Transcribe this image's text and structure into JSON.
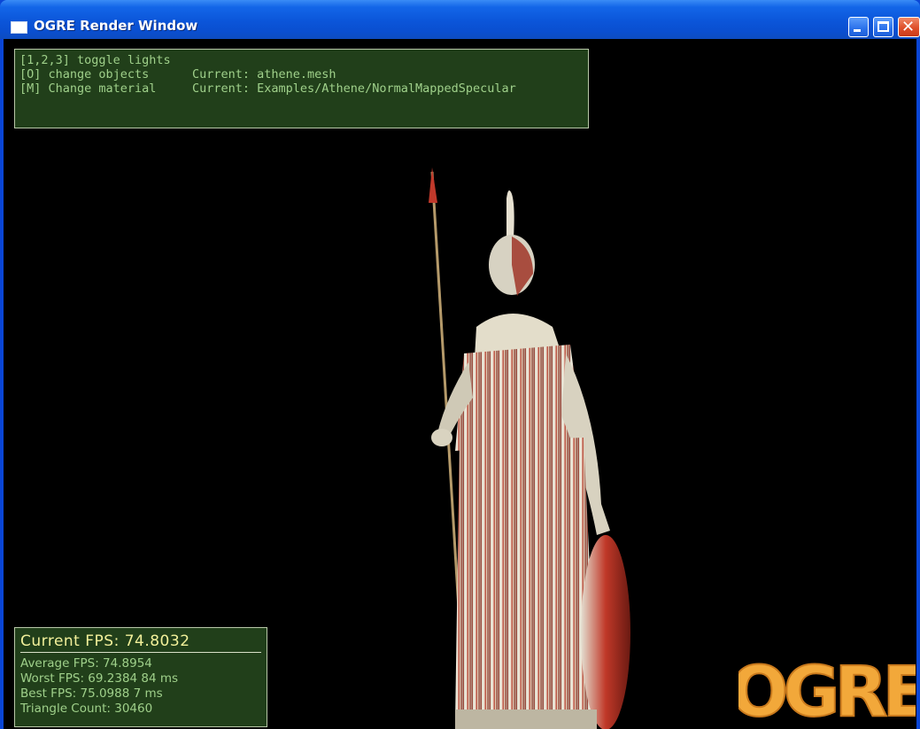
{
  "window": {
    "title": "OGRE Render Window",
    "controls": {
      "minimize_icon": "minimize-icon",
      "maximize_icon": "maximize-icon",
      "close_icon": "close-icon"
    }
  },
  "help_overlay": {
    "rows": [
      {
        "key": "[1,2,3] toggle lights",
        "value": ""
      },
      {
        "key": "[O] change objects",
        "value": "Current: athene.mesh"
      },
      {
        "key": "[M] Change material",
        "value": "Current: Examples/Athene/NormalMappedSpecular"
      }
    ]
  },
  "stats_overlay": {
    "current_fps": "Current FPS: 74.8032",
    "average_fps": "Average FPS: 74.8954",
    "worst_fps": "Worst FPS: 69.2384 84 ms",
    "best_fps": "Best FPS: 75.0988 7 ms",
    "triangle_count": "Triangle Count: 30460"
  },
  "logo": {
    "text": "OGRE"
  },
  "colors": {
    "titlebar": "#0a55d9",
    "panel_bg": "#26481e",
    "panel_text": "#9fd08a",
    "fps_text": "#f2f09a",
    "logo": "#f2a83a"
  }
}
